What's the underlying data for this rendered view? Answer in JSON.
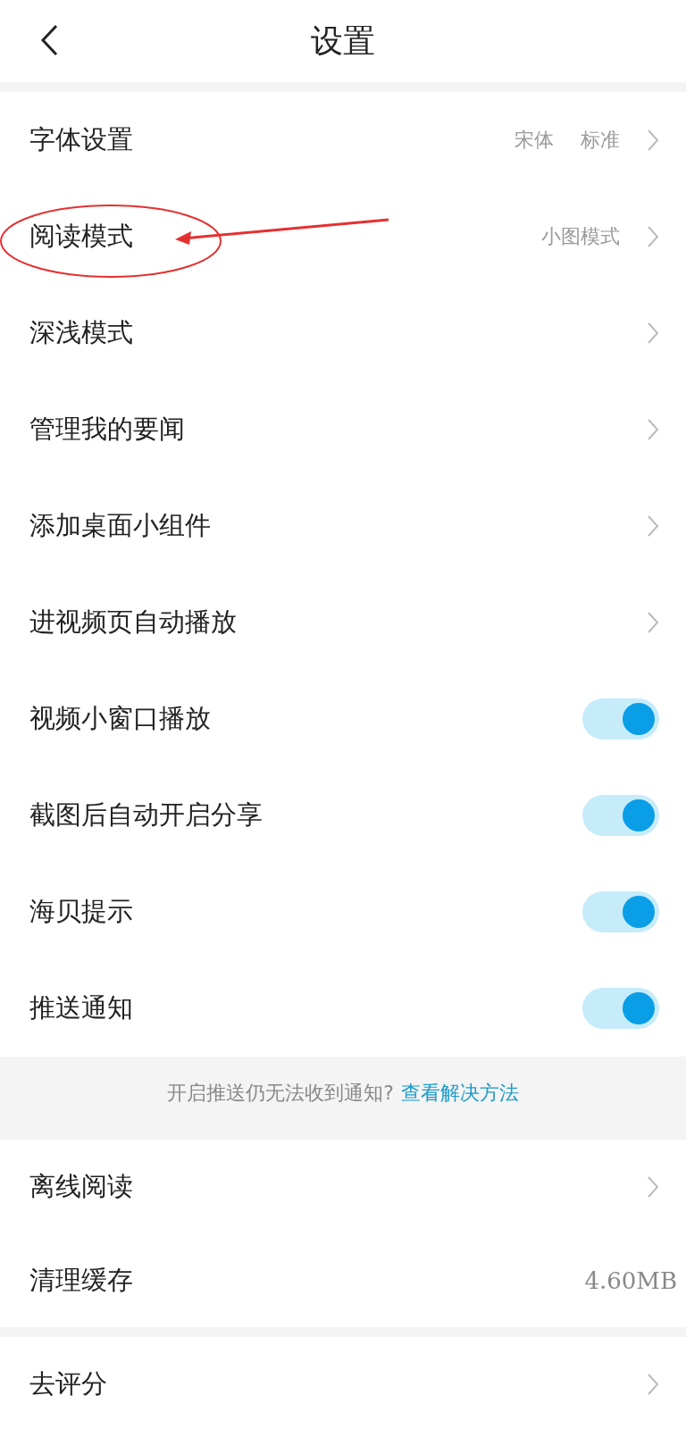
{
  "header": {
    "title": "设置"
  },
  "group_1": [
    {
      "kind": "link",
      "label": "字体设置",
      "values": [
        "宋体",
        "标准"
      ]
    },
    {
      "kind": "link",
      "label": "阅读模式",
      "values": [
        "小图模式"
      ]
    },
    {
      "kind": "link",
      "label": "深浅模式"
    },
    {
      "kind": "link",
      "label": "管理我的要闻"
    },
    {
      "kind": "link",
      "label": "添加桌面小组件"
    },
    {
      "kind": "link",
      "label": "进视频页自动播放"
    },
    {
      "kind": "toggle",
      "label": "视频小窗口播放",
      "on": true
    },
    {
      "kind": "toggle",
      "label": "截图后自动开启分享",
      "on": true
    },
    {
      "kind": "toggle",
      "label": "海贝提示",
      "on": true
    },
    {
      "kind": "toggle",
      "label": "推送通知",
      "on": true
    }
  ],
  "notice": {
    "text": "开启推送仍无法收到通知?",
    "link": "查看解决方法"
  },
  "group_2": [
    {
      "kind": "link",
      "label": "离线阅读"
    },
    {
      "kind": "value",
      "label": "清理缓存",
      "values": [
        "4.60MB"
      ]
    }
  ],
  "group_3": [
    {
      "kind": "link",
      "label": "去评分"
    }
  ]
}
